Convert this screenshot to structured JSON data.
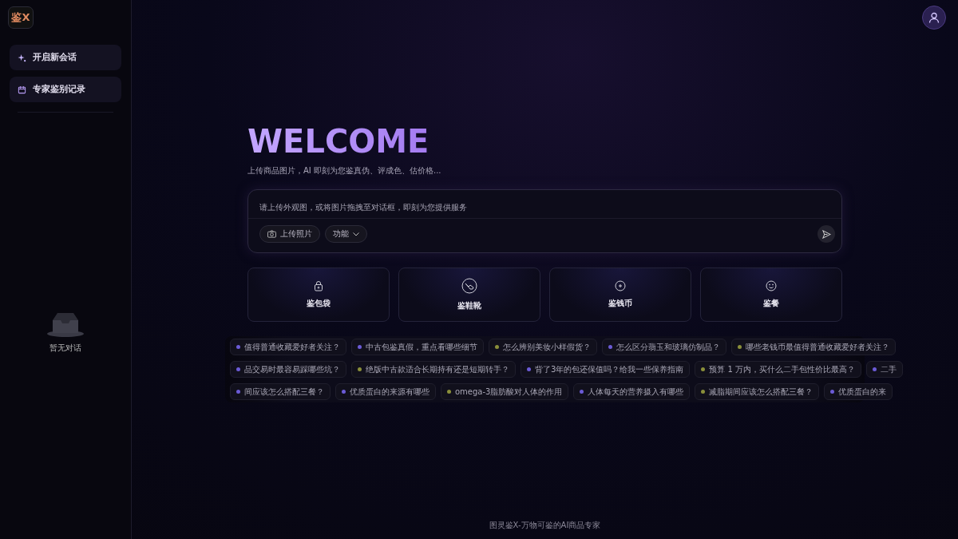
{
  "sidebar": {
    "logo": "鉴X",
    "items": [
      {
        "label": "开启新会话"
      },
      {
        "label": "专家鉴别记录"
      }
    ],
    "empty_state": "暂无对话"
  },
  "welcome": {
    "title": "WELCOME",
    "subtitle": "上传商品图片，AI 即刻为您鉴真伪、评成色、估价格..."
  },
  "composer": {
    "placeholder": "请上传外观图，或将图片拖拽至对话框，即刻为您提供服务",
    "upload_button": "上传照片",
    "function_button": "功能"
  },
  "categories": [
    {
      "label": "鉴包袋"
    },
    {
      "label": "鉴鞋靴"
    },
    {
      "label": "鉴钱币"
    },
    {
      "label": "鉴餐"
    }
  ],
  "suggestion_rows": [
    [
      {
        "text": "值得普通收藏爱好者关注？",
        "color": "#6b5bd6"
      },
      {
        "text": "中古包鉴真假，重点看哪些细节",
        "color": "#6b5bd6"
      },
      {
        "text": "怎么辨别美妆小样假货？",
        "color": "#8a8f3a"
      },
      {
        "text": "怎么区分翡玉和玻璃仿制品？",
        "color": "#6b5bd6"
      },
      {
        "text": "哪些老钱币最值得普通收藏爱好者关注？",
        "color": "#8a8f3a"
      }
    ],
    [
      {
        "text": "品交易时最容易踩哪些坑？",
        "color": "#6b5bd6"
      },
      {
        "text": "绝版中古款适合长期持有还是短期转手？",
        "color": "#8a8f3a"
      },
      {
        "text": "背了3年的包还保值吗？给我一些保养指南",
        "color": "#6b5bd6"
      },
      {
        "text": "预算 1 万内，买什么二手包性价比最高？",
        "color": "#8a8f3a"
      },
      {
        "text": "二手",
        "color": "#6b5bd6"
      }
    ],
    [
      {
        "text": "间应该怎么搭配三餐？",
        "color": "#6b5bd6"
      },
      {
        "text": "优质蛋白的来源有哪些",
        "color": "#6b5bd6"
      },
      {
        "text": "omega-3脂肪酸对人体的作用",
        "color": "#8a8f3a"
      },
      {
        "text": "人体每天的营养摄入有哪些",
        "color": "#6b5bd6"
      },
      {
        "text": "减脂期间应该怎么搭配三餐？",
        "color": "#8a8f3a"
      },
      {
        "text": "优质蛋白的来",
        "color": "#6b5bd6"
      }
    ]
  ],
  "footer": "图灵鉴X-万物可鉴的AI商品专家"
}
